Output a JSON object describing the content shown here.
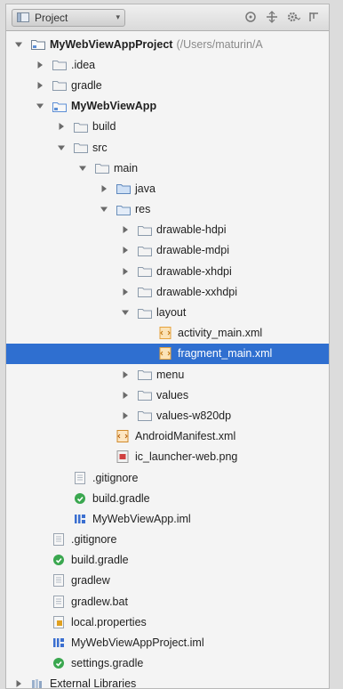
{
  "toolbar": {
    "view_label": "Project",
    "view_icon": "project-view-icon",
    "icons": [
      "sync-icon",
      "collapse-all-icon",
      "settings-icon",
      "hide-panel-icon"
    ]
  },
  "colors": {
    "selection": "#2f6fd0",
    "folder": "#7aa0c8",
    "module_folder": "#5d8fd6",
    "xml_file": "#e6a23c",
    "gradle": "#3aa74f",
    "iml": "#3b6fd0"
  },
  "tree": [
    {
      "label": "MyWebViewAppProject",
      "suffix": "(/Users/maturin/A",
      "depth": 0,
      "expanded": true,
      "icon": "project-folder-icon",
      "bold": true
    },
    {
      "label": ".idea",
      "depth": 1,
      "expanded": false,
      "icon": "folder-icon"
    },
    {
      "label": "gradle",
      "depth": 1,
      "expanded": false,
      "icon": "folder-icon"
    },
    {
      "label": "MyWebViewApp",
      "depth": 1,
      "expanded": true,
      "icon": "module-folder-icon",
      "bold": true
    },
    {
      "label": "build",
      "depth": 2,
      "expanded": false,
      "icon": "folder-icon"
    },
    {
      "label": "src",
      "depth": 2,
      "expanded": true,
      "icon": "folder-icon"
    },
    {
      "label": "main",
      "depth": 3,
      "expanded": true,
      "icon": "folder-icon"
    },
    {
      "label": "java",
      "depth": 4,
      "expanded": false,
      "icon": "source-folder-icon"
    },
    {
      "label": "res",
      "depth": 4,
      "expanded": true,
      "icon": "resource-folder-icon"
    },
    {
      "label": "drawable-hdpi",
      "depth": 5,
      "expanded": false,
      "icon": "folder-icon"
    },
    {
      "label": "drawable-mdpi",
      "depth": 5,
      "expanded": false,
      "icon": "folder-icon"
    },
    {
      "label": "drawable-xhdpi",
      "depth": 5,
      "expanded": false,
      "icon": "folder-icon"
    },
    {
      "label": "drawable-xxhdpi",
      "depth": 5,
      "expanded": false,
      "icon": "folder-icon"
    },
    {
      "label": "layout",
      "depth": 5,
      "expanded": true,
      "icon": "folder-icon"
    },
    {
      "label": "activity_main.xml",
      "depth": 6,
      "icon": "xml-file-icon"
    },
    {
      "label": "fragment_main.xml",
      "depth": 6,
      "icon": "xml-file-icon",
      "selected": true
    },
    {
      "label": "menu",
      "depth": 5,
      "expanded": false,
      "icon": "folder-icon"
    },
    {
      "label": "values",
      "depth": 5,
      "expanded": false,
      "icon": "folder-icon"
    },
    {
      "label": "values-w820dp",
      "depth": 5,
      "expanded": false,
      "icon": "folder-icon"
    },
    {
      "label": "AndroidManifest.xml",
      "depth": 4,
      "icon": "manifest-file-icon"
    },
    {
      "label": "ic_launcher-web.png",
      "depth": 4,
      "icon": "image-file-icon"
    },
    {
      "label": ".gitignore",
      "depth": 2,
      "icon": "text-file-icon"
    },
    {
      "label": "build.gradle",
      "depth": 2,
      "icon": "gradle-file-icon"
    },
    {
      "label": "MyWebViewApp.iml",
      "depth": 2,
      "icon": "iml-file-icon"
    },
    {
      "label": ".gitignore",
      "depth": 1,
      "icon": "text-file-icon"
    },
    {
      "label": "build.gradle",
      "depth": 1,
      "icon": "gradle-file-icon"
    },
    {
      "label": "gradlew",
      "depth": 1,
      "icon": "text-file-icon"
    },
    {
      "label": "gradlew.bat",
      "depth": 1,
      "icon": "text-file-icon"
    },
    {
      "label": "local.properties",
      "depth": 1,
      "icon": "properties-file-icon"
    },
    {
      "label": "MyWebViewAppProject.iml",
      "depth": 1,
      "icon": "iml-file-icon"
    },
    {
      "label": "settings.gradle",
      "depth": 1,
      "icon": "gradle-file-icon"
    },
    {
      "label": "External Libraries",
      "depth": 0,
      "expanded": false,
      "icon": "libraries-icon"
    }
  ]
}
